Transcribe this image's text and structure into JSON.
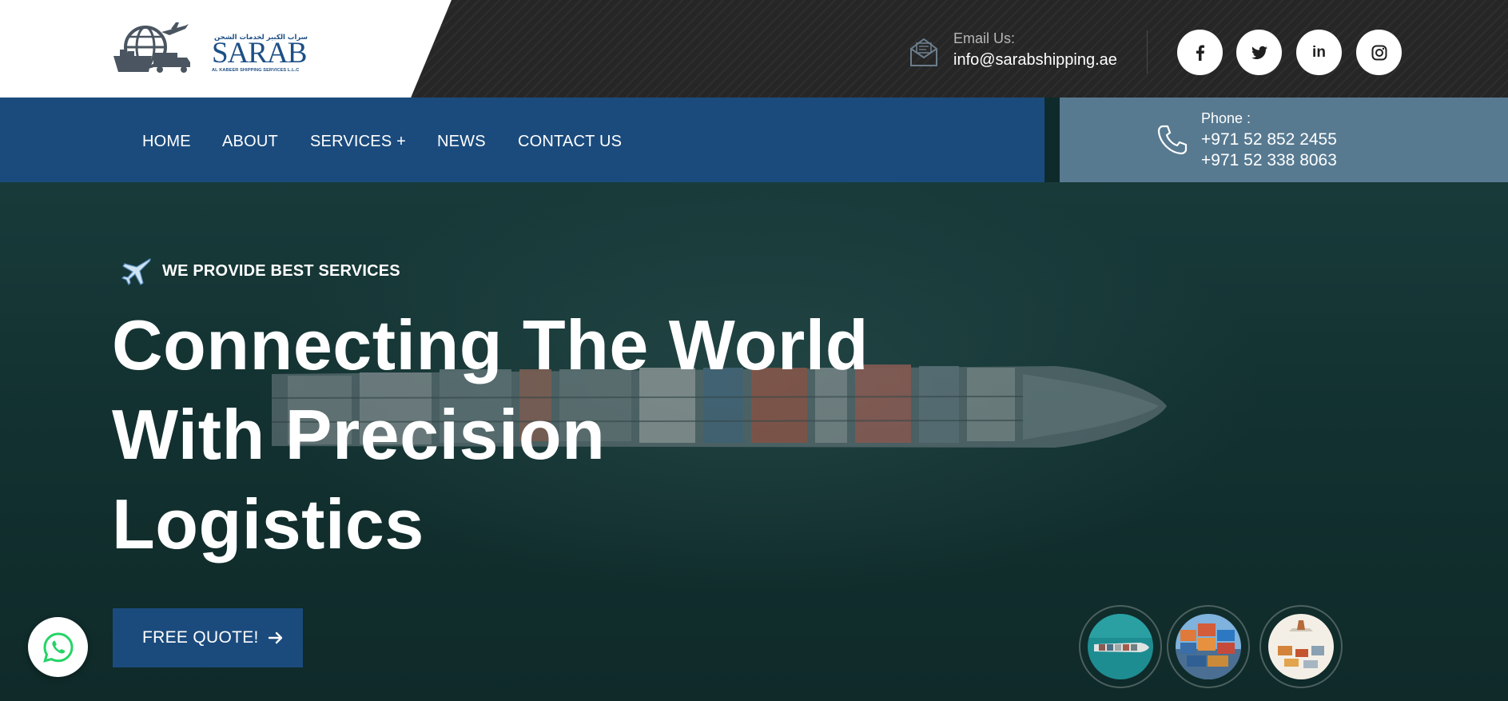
{
  "brand": {
    "name": "SARAB",
    "arabic_name": "سراب الكبير لخدمات الشحن",
    "subtitle": "AL KABEER SHIPPING SERVICES L.L.C",
    "accent_color": "#1b4b7d"
  },
  "header": {
    "email_label": "Email Us:",
    "email_value": "info@sarabshipping.ae",
    "email_icon": "envelope-icon",
    "social": [
      {
        "name": "facebook",
        "icon": "facebook-icon"
      },
      {
        "name": "twitter",
        "icon": "twitter-icon"
      },
      {
        "name": "linkedin",
        "icon": "linkedin-icon",
        "glyph": "in"
      },
      {
        "name": "instagram",
        "icon": "instagram-icon"
      }
    ]
  },
  "nav": {
    "items": [
      {
        "label": "HOME"
      },
      {
        "label": "ABOUT"
      },
      {
        "label": "SERVICES +"
      },
      {
        "label": "NEWS"
      },
      {
        "label": "CONTACT US"
      }
    ],
    "background": "#1b4b7d"
  },
  "contact": {
    "phone_label": "Phone :",
    "phone_1": "+971 52 852 2455",
    "phone_2": "+971 52 338 8063",
    "phone_icon": "phone-icon",
    "background": "#577a91"
  },
  "hero": {
    "tagline": "WE PROVIDE BEST SERVICES",
    "tagline_icon": "airplane-icon",
    "title_lines": [
      "Connecting The World",
      "With Precision",
      "Logistics"
    ],
    "cta_label": "FREE QUOTE!",
    "cta_icon": "arrow-right-icon",
    "thumbnails": [
      {
        "icon": "cargo-ship-thumbnail"
      },
      {
        "icon": "containers-thumbnail"
      },
      {
        "icon": "airplane-cargo-thumbnail"
      }
    ]
  },
  "floating": {
    "whatsapp_icon": "whatsapp-icon",
    "whatsapp_color": "#25d366"
  }
}
